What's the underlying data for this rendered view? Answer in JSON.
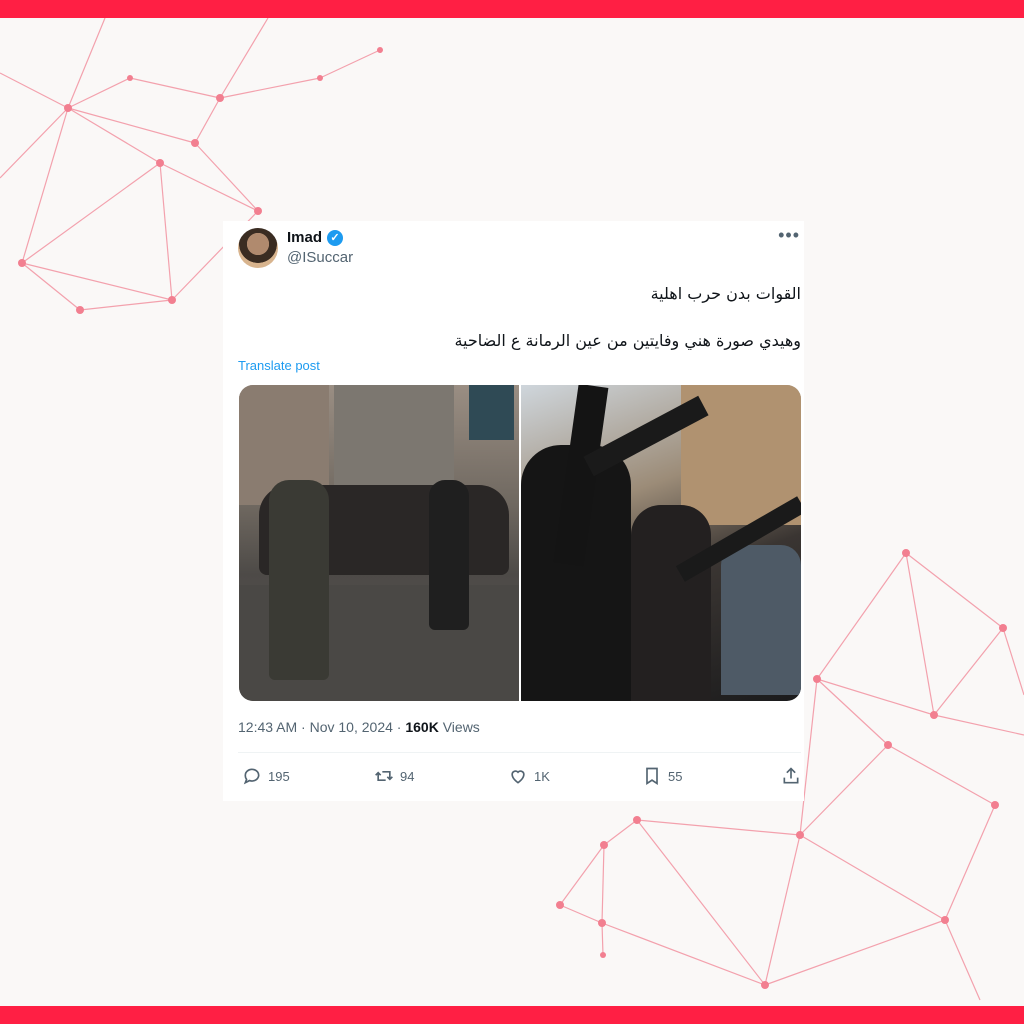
{
  "tweet": {
    "author_name": "Imad",
    "author_handle": "@ISuccar",
    "text_line1": "القوات بدن حرب اهلية",
    "text_line2": "وهيدي صورة هني وفايتين من عين الرمانة ع الضاحية",
    "translate_label": "Translate post",
    "time": "12:43 AM",
    "date": "Nov 10, 2024",
    "views_count": "160K",
    "views_label": "Views",
    "separator": "·"
  },
  "actions": {
    "replies": "195",
    "reposts": "94",
    "likes": "1K",
    "bookmarks": "55"
  },
  "icons": {
    "more": "more-options-icon",
    "verified": "verified-badge-icon",
    "reply": "reply-icon",
    "repost": "repost-icon",
    "like": "heart-icon",
    "bookmark": "bookmark-icon",
    "share": "share-icon"
  },
  "colors": {
    "frame_bar": "#ff1f44",
    "link": "#1d9bf0",
    "muted_text": "#536471"
  }
}
